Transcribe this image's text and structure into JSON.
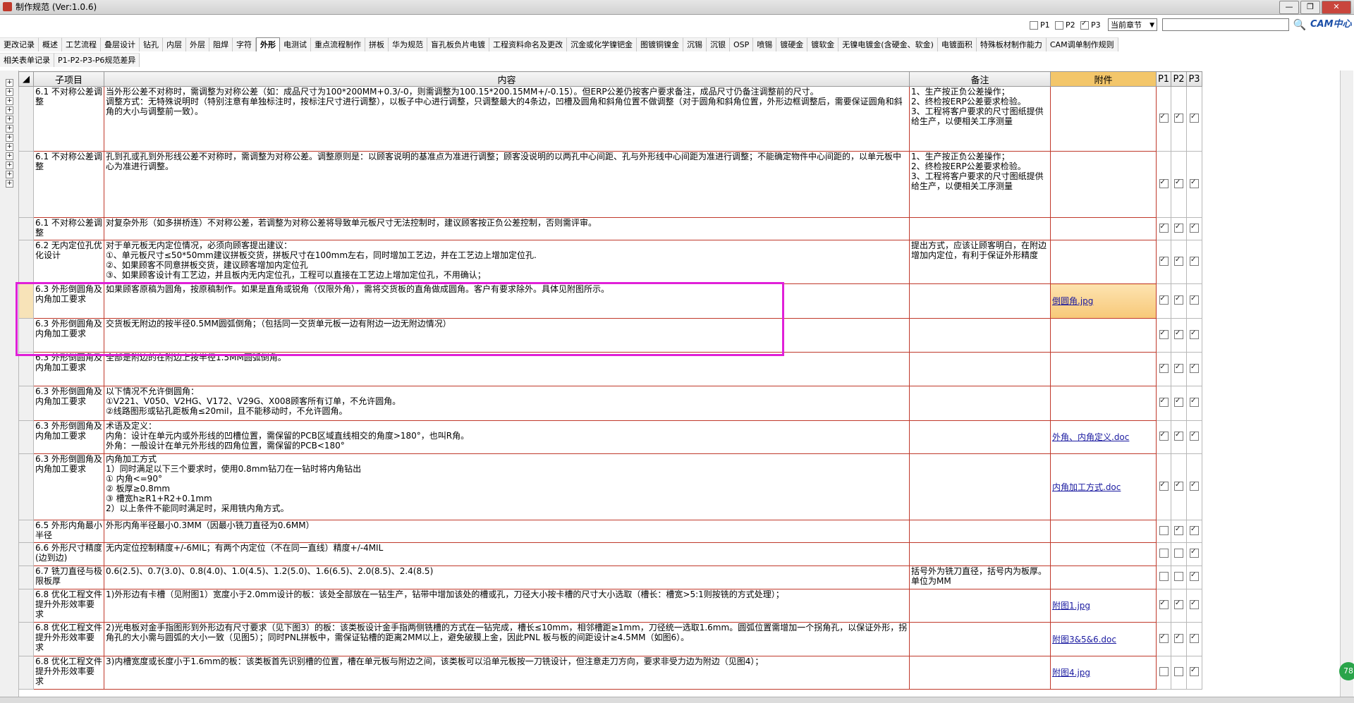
{
  "window": {
    "title": "制作规范 (Ver:1.0.6)",
    "buttons": [
      "—",
      "❐",
      "✕"
    ]
  },
  "filters": {
    "p1": {
      "label": "P1",
      "checked": false
    },
    "p2": {
      "label": "P2",
      "checked": false
    },
    "p3": {
      "label": "P3",
      "checked": true
    },
    "scope_value": "当前章节",
    "search_placeholder": "",
    "logo": "CAM中心"
  },
  "tabs_row1": [
    {
      "label": "更改记录"
    },
    {
      "label": "概述"
    },
    {
      "label": "工艺流程"
    },
    {
      "label": "叠层设计"
    },
    {
      "label": "钻孔"
    },
    {
      "label": "内层"
    },
    {
      "label": "外层"
    },
    {
      "label": "阻焊"
    },
    {
      "label": "字符"
    },
    {
      "label": "外形",
      "active": true
    },
    {
      "label": "电测试"
    },
    {
      "label": "重点流程制作"
    },
    {
      "label": "拼板"
    },
    {
      "label": "华为规范"
    },
    {
      "label": "盲孔板负片电镀"
    },
    {
      "label": "工程资料命名及更改"
    },
    {
      "label": "沉金或化学镍钯金"
    },
    {
      "label": "图镀铜镍金"
    },
    {
      "label": "沉锡"
    },
    {
      "label": "沉银"
    },
    {
      "label": "OSP"
    },
    {
      "label": "喷锡"
    },
    {
      "label": "镀硬金"
    },
    {
      "label": "镀软金"
    },
    {
      "label": "无镍电镀金(含硬金、软金)"
    },
    {
      "label": "电镀面积"
    },
    {
      "label": "特殊板材制作能力"
    },
    {
      "label": "CAM调单制作规则"
    }
  ],
  "tabs_row2": [
    {
      "label": "相关表单记录"
    },
    {
      "label": "P1-P2-P3-P6规范差异"
    }
  ],
  "columns": {
    "sub": "子项目",
    "content": "内容",
    "note": "备注",
    "attach": "附件",
    "p1": "P1",
    "p2": "P2",
    "p3": "P3"
  },
  "rows": [
    {
      "sub": "6.1 不对称公差调整",
      "content": "当外形公差不对称时，需调整为对称公差（如：成品尺寸为100*200MM+0.3/-0，则需调整为100.15*200.15MM+/-0.15）。但ERP公差仍按客户要求备注，成品尺寸仍备注调整前的尺寸。\n调整方式：无特殊说明时（特别注意有单独标注时，按标注尺寸进行调整），以板子中心进行调整，只调整最大的4条边，凹槽及圆角和斜角位置不做调整（对于圆角和斜角位置，外形边框调整后，需要保证圆角和斜角的大小与调整前一致）。",
      "note": "1、生产按正负公差操作；\n2、终检按ERP公差要求检验。\n3、工程将客户要求的尺寸图纸提供给生产，以便相关工序测量",
      "attach": "",
      "p1": true,
      "p2": true,
      "p3": true
    },
    {
      "sub": "6.1 不对称公差调整",
      "content": "孔到孔或孔到外形线公差不对称时，需调整为对称公差。调整原则是：以顾客说明的基准点为准进行调整；顾客没说明的以两孔中心间距、孔与外形线中心间距为准进行调整；不能确定物件中心间距的，以单元板中心为准进行调整。",
      "note": "1、生产按正负公差操作；\n2、终检按ERP公差要求检验。\n3、工程将客户要求的尺寸图纸提供给生产，以便相关工序测量",
      "attach": "",
      "p1": true,
      "p2": true,
      "p3": true
    },
    {
      "sub": "6.1 不对称公差调整",
      "content": "对复杂外形（如多拼桥连）不对称公差，若调整为对称公差将导致单元板尺寸无法控制时，建议顾客按正负公差控制，否则需评审。",
      "note": "",
      "attach": "",
      "p1": true,
      "p2": true,
      "p3": true
    },
    {
      "sub": "6.2 无内定位孔优化设计",
      "content": "对于单元板无内定位情况，必须向顾客提出建议：\n①、单元板尺寸≤50*50mm建议拼板交货，拼板尺寸在100mm左右，同时增加工艺边，并在工艺边上增加定位孔.\n②、如果顾客不同意拼板交货，建议顾客增加内定位孔\n③、如果顾客设计有工艺边，并且板内无内定位孔，工程可以直接在工艺边上增加定位孔，不用确认；",
      "note": "提出方式，应该让顾客明白，在附边增加内定位，有利于保证外形精度",
      "attach": "",
      "p1": true,
      "p2": true,
      "p3": true
    },
    {
      "sub": "6.3 外形倒圆角及内角加工要求",
      "content": "如果顾客原稿为圆角，按原稿制作。如果是直角或锐角（仅限外角），需将交货板的直角做成圆角。客户有要求除外。具体见附图所示。",
      "note": "",
      "attach": "倒圆角.jpg",
      "highlight": true,
      "p1": true,
      "p2": true,
      "p3": true
    },
    {
      "sub": "6.3 外形倒圆角及内角加工要求",
      "content": "交货板无附边的按半径0.5MM圆弧倒角；（包括同一交货单元板一边有附边一边无附边情况）",
      "note": "",
      "attach": "",
      "p1": true,
      "p2": true,
      "p3": true
    },
    {
      "sub": "6.3 外形倒圆角及内角加工要求",
      "content": "全部是附边的在附边上按半径1.5MM圆弧倒角。",
      "note": "",
      "attach": "",
      "p1": true,
      "p2": true,
      "p3": true
    },
    {
      "sub": "6.3 外形倒圆角及内角加工要求",
      "content": "以下情况不允许倒圆角：\n①V221、V050、V2HG、V172、V29G、X008顾客所有订单，不允许圆角。\n②线路图形或钻孔距板角≤20mil，且不能移动时，不允许圆角。",
      "note": "",
      "attach": "",
      "p1": true,
      "p2": true,
      "p3": true
    },
    {
      "sub": "6.3 外形倒圆角及内角加工要求",
      "content": "术语及定义：\n内角：设计在单元内或外形线的凹槽位置，需保留的PCB区域直线相交的角度>180°，也叫R角。\n外角：一般设计在单元外形线的四角位置，需保留的PCB<180°",
      "note": "",
      "attach": "外角、内角定义.doc",
      "p1": true,
      "p2": true,
      "p3": true
    },
    {
      "sub": "6.3 外形倒圆角及内角加工要求",
      "content": "内角加工方式\n1）同时满足以下三个要求时，使用0.8mm钻刀在一钻时将内角钻出\n① 内角<=90°\n② 板厚≥0.8mm\n③ 槽宽h≥R1+R2+0.1mm\n2）以上条件不能同时满足时，采用铣内角方式。",
      "note": "",
      "attach": "内角加工方式.doc",
      "p1": true,
      "p2": true,
      "p3": true
    },
    {
      "sub": "6.5 外形内角最小半径",
      "content": "外形内角半径最小0.3MM（因最小铣刀直径为0.6MM）",
      "note": "",
      "attach": "",
      "p1": false,
      "p2": true,
      "p3": true
    },
    {
      "sub": "6.6 外形尺寸精度(边到边)",
      "content": "无内定位控制精度+/-6MIL；有两个内定位（不在同一直线）精度+/-4MIL",
      "note": "",
      "attach": "",
      "p1": false,
      "p2": false,
      "p3": true
    },
    {
      "sub": "6.7 铣刀直径与极限板厚",
      "content": "0.6(2.5)、0.7(3.0)、0.8(4.0)、1.0(4.5)、1.2(5.0)、1.6(6.5)、2.0(8.5)、2.4(8.5)",
      "note": "括号外为铣刀直径，括号内为板厚。单位为MM",
      "attach": "",
      "p1": false,
      "p2": false,
      "p3": true
    },
    {
      "sub": "6.8 优化工程文件提升外形效率要求",
      "content": "1)外形边有卡槽（见附图1）宽度小于2.0mm设计的板：该处全部放在一钻生产，钻带中增加该处的槽或孔，刀径大小按卡槽的尺寸大小选取（槽长：槽宽>5:1则按铣的方式处理）；",
      "note": "",
      "attach": "附图1.jpg",
      "p1": true,
      "p2": true,
      "p3": true
    },
    {
      "sub": "6.8 优化工程文件提升外形效率要求",
      "content": "2)光电板对金手指图形到外形边有尺寸要求（见下图3）的板：该类板设计金手指两侧铣槽的方式在一钻完成，槽长≤10mm，相邻槽距≥1mm，刀径统一选取1.6mm。圆弧位置需增加一个拐角孔，以保证外形，拐角孔的大小需与圆弧的大小一致（见图5）；同时PNL拼板中，需保证钻槽的距离2MM以上，避免破膜上金，因此PNL 板与板的间距设计≥4.5MM（如图6）。",
      "note": "",
      "attach": "附图3&5&6.doc",
      "p1": true,
      "p2": true,
      "p3": true
    },
    {
      "sub": "6.8 优化工程文件提升外形效率要求",
      "content": "3)内槽宽度或长度小于1.6mm的板：该类板首先识别槽的位置，槽在单元板与附边之间，该类板可以沿单元板按一刀铣设计，但注意走刀方向，要求非受力边为附边（见图4）；",
      "note": "",
      "attach": "附图4.jpg",
      "p1": false,
      "p2": false,
      "p3": true
    }
  ],
  "status": {
    "badge": "78"
  }
}
